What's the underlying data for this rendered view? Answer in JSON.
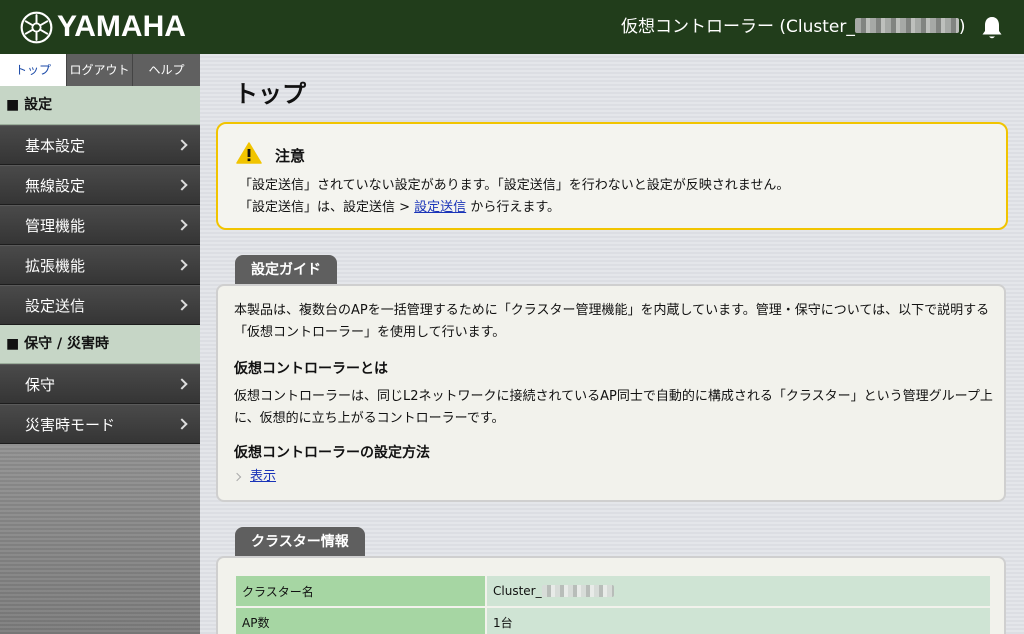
{
  "header": {
    "brand": "YAMAHA",
    "controller_title": "仮想コントローラー (Cluster_",
    "controller_title_end": ")"
  },
  "sidebar": {
    "tabs": [
      "トップ",
      "ログアウト",
      "ヘルプ"
    ],
    "sections": [
      {
        "title": "■ 設定",
        "items": [
          "基本設定",
          "無線設定",
          "管理機能",
          "拡張機能",
          "設定送信"
        ]
      },
      {
        "title": "■ 保守 / 災害時",
        "items": [
          "保守",
          "災害時モード"
        ]
      }
    ]
  },
  "main": {
    "title": "トップ",
    "alert": {
      "title": "注意",
      "line1": "「設定送信」されていない設定があります。「設定送信」を行わないと設定が反映されません。",
      "line2_prefix": "「設定送信」は、設定送信 > ",
      "line2_link": "設定送信",
      "line2_suffix": " から行えます。"
    },
    "guide": {
      "tab": "設定ガイド",
      "intro": "本製品は、複数台のAPを一括管理するために「クラスター管理機能」を内蔵しています。管理・保守については、以下で説明する「仮想コントローラー」を使用して行います。",
      "heading1": "仮想コントローラーとは",
      "body1": "仮想コントローラーは、同じL2ネットワークに接続されているAP同士で自動的に構成される「クラスター」という管理グループ上に、仮想的に立ち上がるコントローラーです。",
      "heading2": "仮想コントローラーの設定方法",
      "link": "表示"
    },
    "cluster_info": {
      "tab": "クラスター情報",
      "rows": [
        {
          "key": "クラスター名",
          "value": "Cluster_"
        },
        {
          "key": "AP数",
          "value": "1台"
        }
      ]
    }
  }
}
